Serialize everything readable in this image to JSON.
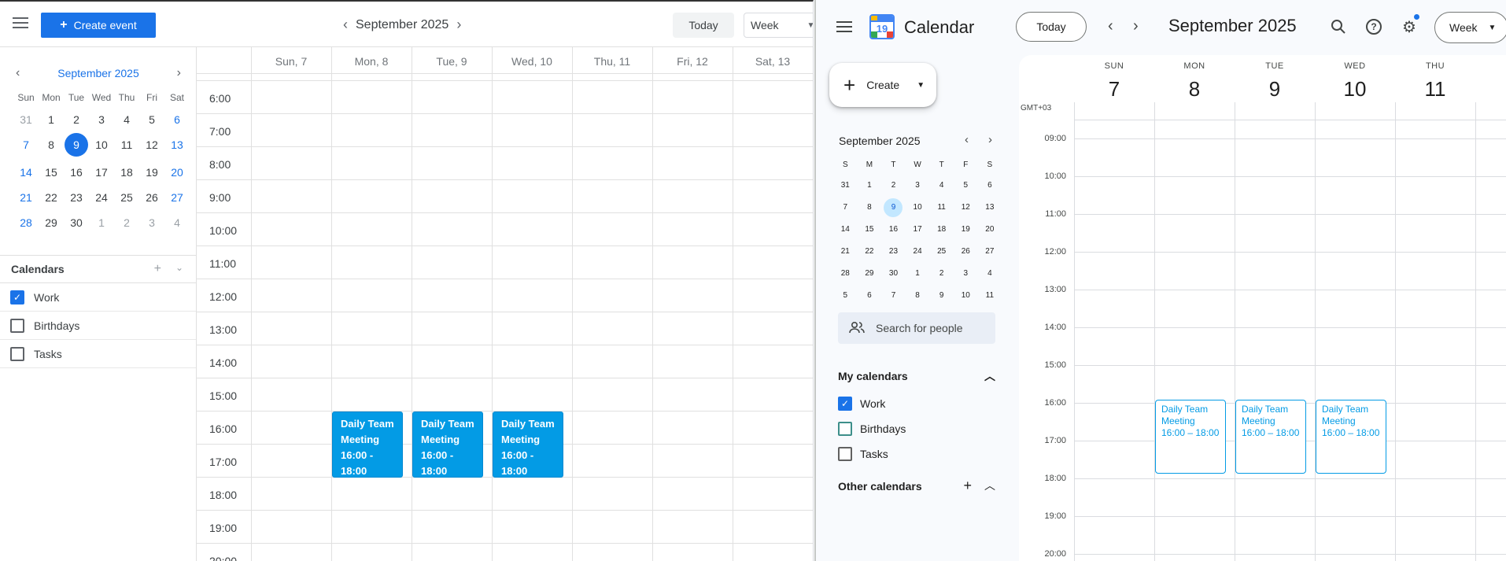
{
  "left_app": {
    "create_label": "Create event",
    "nav_title": "September 2025",
    "today_label": "Today",
    "view_label": "Week",
    "mini_calendar": {
      "title": "September 2025",
      "weekdays": [
        "Sun",
        "Mon",
        "Tue",
        "Wed",
        "Thu",
        "Fri",
        "Sat"
      ],
      "weeks": [
        [
          "31",
          "1",
          "2",
          "3",
          "4",
          "5",
          "6"
        ],
        [
          "7",
          "8",
          "9",
          "10",
          "11",
          "12",
          "13"
        ],
        [
          "14",
          "15",
          "16",
          "17",
          "18",
          "19",
          "20"
        ],
        [
          "21",
          "22",
          "23",
          "24",
          "25",
          "26",
          "27"
        ],
        [
          "28",
          "29",
          "30",
          "1",
          "2",
          "3",
          "4"
        ]
      ],
      "selected": "9"
    },
    "calendars": {
      "heading": "Calendars",
      "items": [
        {
          "label": "Work",
          "checked": true
        },
        {
          "label": "Birthdays",
          "checked": false
        },
        {
          "label": "Tasks",
          "checked": false
        }
      ]
    },
    "day_headers": [
      "Sun, 7",
      "Mon, 8",
      "Tue, 9",
      "Wed, 10",
      "Thu, 11",
      "Fri, 12",
      "Sat, 13"
    ],
    "hours": [
      "6:00",
      "7:00",
      "8:00",
      "9:00",
      "10:00",
      "11:00",
      "12:00",
      "13:00",
      "14:00",
      "15:00",
      "16:00",
      "17:00",
      "18:00",
      "19:00",
      "20:00"
    ],
    "events": [
      {
        "title": "Daily Team Meeting",
        "time": "16:00 - 18:00",
        "day": "Mon, 8"
      },
      {
        "title": "Daily Team Meeting",
        "time": "16:00 - 18:00",
        "day": "Tue, 9"
      },
      {
        "title": "Daily Team Meeting",
        "time": "16:00 - 18:00",
        "day": "Wed, 10"
      }
    ],
    "colors": {
      "accent": "#1a73e8",
      "event": "#039be5"
    }
  },
  "right_app": {
    "app_title": "Calendar",
    "logo_number": "19",
    "today_label": "Today",
    "month_title": "September 2025",
    "view_label": "Week",
    "create_label": "Create",
    "mini_calendar": {
      "title": "September 2025",
      "weekdays": [
        "S",
        "M",
        "T",
        "W",
        "T",
        "F",
        "S"
      ],
      "weeks": [
        [
          "31",
          "1",
          "2",
          "3",
          "4",
          "5",
          "6"
        ],
        [
          "7",
          "8",
          "9",
          "10",
          "11",
          "12",
          "13"
        ],
        [
          "14",
          "15",
          "16",
          "17",
          "18",
          "19",
          "20"
        ],
        [
          "21",
          "22",
          "23",
          "24",
          "25",
          "26",
          "27"
        ],
        [
          "28",
          "29",
          "30",
          "1",
          "2",
          "3",
          "4"
        ],
        [
          "5",
          "6",
          "7",
          "8",
          "9",
          "10",
          "11"
        ]
      ],
      "selected": "9"
    },
    "search_placeholder": "Search for people",
    "my_calendars": {
      "heading": "My calendars",
      "items": [
        {
          "label": "Work",
          "checked": true
        },
        {
          "label": "Birthdays",
          "checked": false
        },
        {
          "label": "Tasks",
          "checked": false
        }
      ]
    },
    "other_calendars_heading": "Other calendars",
    "timezone": "GMT+03",
    "day_headers": [
      {
        "name": "SUN",
        "date": "7"
      },
      {
        "name": "MON",
        "date": "8"
      },
      {
        "name": "TUE",
        "date": "9"
      },
      {
        "name": "WED",
        "date": "10"
      },
      {
        "name": "THU",
        "date": "11"
      }
    ],
    "hours": [
      "09:00",
      "10:00",
      "11:00",
      "12:00",
      "13:00",
      "14:00",
      "15:00",
      "16:00",
      "17:00",
      "18:00",
      "19:00",
      "20:00"
    ],
    "events": [
      {
        "title": "Daily Team Meeting",
        "time": "16:00 – 18:00",
        "day": "MON"
      },
      {
        "title": "Daily Team Meeting",
        "time": "16:00 – 18:00",
        "day": "TUE"
      },
      {
        "title": "Daily Team Meeting",
        "time": "16:00 – 18:00",
        "day": "WED"
      }
    ],
    "colors": {
      "accent": "#1a73e8",
      "event_outline": "#039be5",
      "selected_day": "#c2e7ff"
    }
  }
}
